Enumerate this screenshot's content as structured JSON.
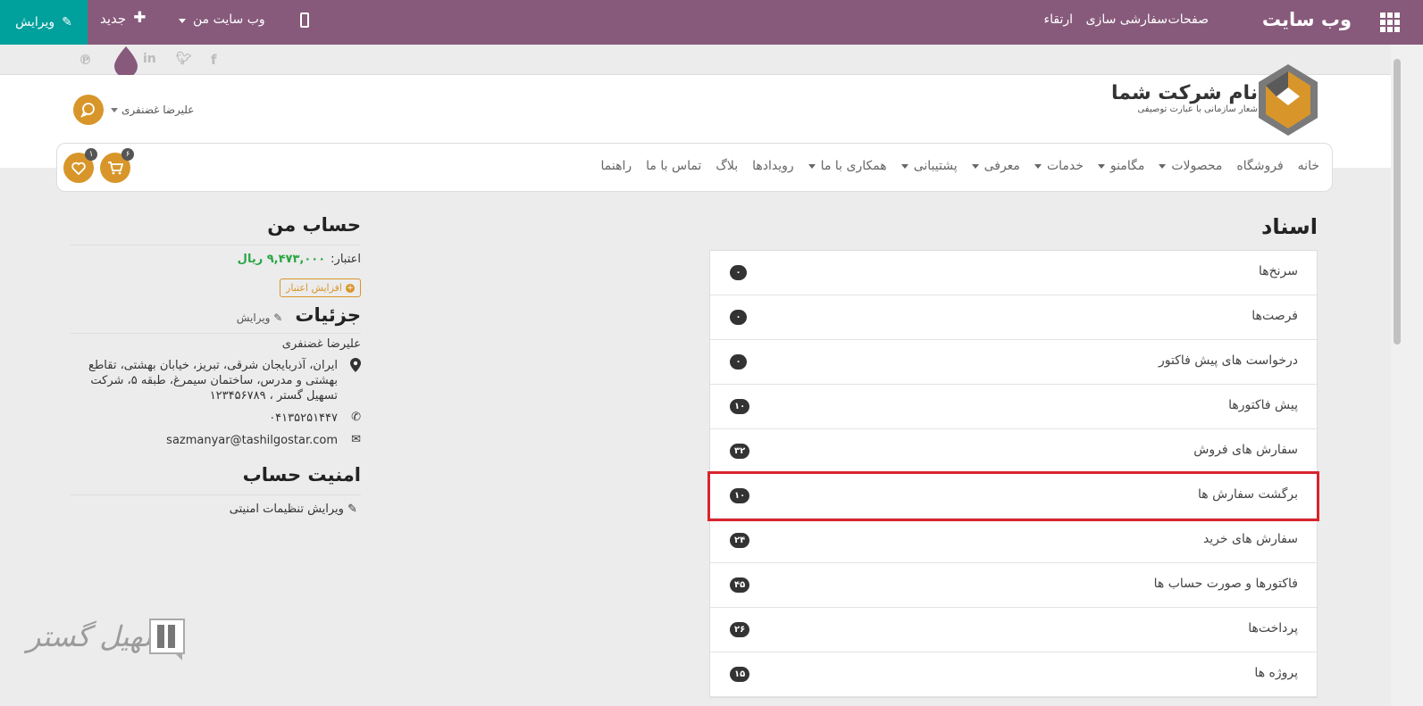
{
  "topbar": {
    "brand": "وب سایت",
    "menu": [
      "صفحات",
      "سفارشی سازی",
      "ارتقاء"
    ],
    "my_site": "وب سایت من",
    "new_label": "جدید",
    "edit_label": "ویرایش"
  },
  "header": {
    "company_name": "نام شرکت شما",
    "tagline": "شعار سازمانی با عبارت توصیفی",
    "user_name": "علیرضا غضنفری"
  },
  "nav": {
    "items": [
      {
        "label": "خانه",
        "dropdown": false
      },
      {
        "label": "فروشگاه",
        "dropdown": false
      },
      {
        "label": "محصولات",
        "dropdown": true
      },
      {
        "label": "مگامنو",
        "dropdown": true
      },
      {
        "label": "خدمات",
        "dropdown": true
      },
      {
        "label": "معرفی",
        "dropdown": true
      },
      {
        "label": "پشتیبانی",
        "dropdown": true
      },
      {
        "label": "همکاری با ما",
        "dropdown": true
      },
      {
        "label": "رویدادها",
        "dropdown": false
      },
      {
        "label": "بلاگ",
        "dropdown": false
      },
      {
        "label": "تماس با ما",
        "dropdown": false
      },
      {
        "label": "راهنما",
        "dropdown": false
      }
    ],
    "cart_count": "۶",
    "wishlist_count": "۱"
  },
  "documents": {
    "title": "اسناد",
    "rows": [
      {
        "label": "سرنخ‌ها",
        "count": "۰"
      },
      {
        "label": "فرصت‌ها",
        "count": "۰"
      },
      {
        "label": "درخواست های پیش فاکتور",
        "count": "۰"
      },
      {
        "label": "پیش فاکتورها",
        "count": "۱۰"
      },
      {
        "label": "سفارش های فروش",
        "count": "۳۲"
      },
      {
        "label": "برگشت سفارش ها",
        "count": "۱۰",
        "highlighted": true
      },
      {
        "label": "سفارش های خرید",
        "count": "۲۴"
      },
      {
        "label": "فاکتورها و صورت حساب ها",
        "count": "۴۵"
      },
      {
        "label": "پرداخت‌ها",
        "count": "۲۶"
      },
      {
        "label": "پروژه ها",
        "count": "۱۵"
      }
    ]
  },
  "account": {
    "title": "حساب من",
    "credit_label": "اعتبار:",
    "credit_value": "۹,۴۷۳,۰۰۰ ریال",
    "add_credit": "افزایش اعتبار",
    "details_title": "جزئیات",
    "details_edit": "ویرایش",
    "name": "علیرضا غضنفری",
    "address": "ایران، آذربایجان شرقی، تبریز، خیابان بهشتی، تقاطع بهشتی و مدرس، ساختمان سیمرغ، طبقه ۵، شرکت تسهیل گستر ، ۱۲۳۴۵۶۷۸۹",
    "phone": "۰۴۱۳۵۲۵۱۴۴۷",
    "email": "sazmanyar@tashilgostar.com",
    "security_title": "امنیت حساب",
    "security_edit": "ویرایش تنظیمات امنیتی"
  },
  "watermark": "تسهیل گستر",
  "colors": {
    "admin_bar": "#875a7b",
    "edit_button": "#00a09d",
    "accent": "#d8962a",
    "credit": "#28a745",
    "highlight": "#d9232e"
  }
}
